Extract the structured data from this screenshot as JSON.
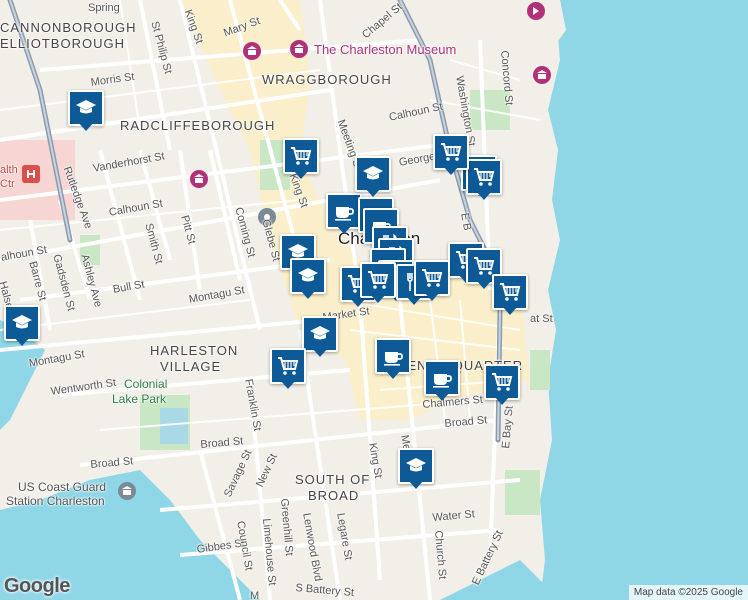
{
  "map": {
    "neighborhoods": {
      "cannonborough": "CANNONBOROUGH",
      "elliotborough": "ELLIOTBOROUGH",
      "wraggborough": "WRAGGBOROUGH",
      "radcliffeborough": "RADCLIFFEBOROUGH",
      "harleston": "HARLESTON",
      "village": "VILLAGE",
      "south_of": "SOUTH OF",
      "broad": "BROAD",
      "french_quarter": "FRENCH QUARTER"
    },
    "city": "Charleston",
    "parks": {
      "colonial_1": "Colonial",
      "colonial_2": "Lake Park"
    },
    "pois": {
      "museum": "The Charleston Museum",
      "coast_guard_1": "US Coast Guard",
      "coast_guard_2": "Station Charleston",
      "hospital_1": "alth",
      "hospital_2": "Ctr"
    },
    "streets": {
      "spring": "Spring",
      "king_top": "King St",
      "mary": "Mary St",
      "chapel": "Chapel St",
      "st_philip": "St Philip St",
      "morris": "Morris St",
      "concord": "Concord St",
      "washington": "Washington St",
      "calhoun_top": "Calhoun St",
      "rutledge": "Rutledge Ave",
      "vanderhorst": "Vanderhorst St",
      "meeting": "Meeting St",
      "george": "George St",
      "king_mid": "King St",
      "calhoun_left": "Calhoun St",
      "calhoun_far_left": "alhoun St",
      "smith": "Smith St",
      "pitt": "Pitt St",
      "coming": "Coming St",
      "glebe": "Glebe St",
      "barre": "Barre St",
      "gadsden": "Gadsden St",
      "ashley": "Ashley Ave",
      "bull": "Bull St",
      "montagu_mid": "Montagu St",
      "montagu_left": "Montagu St",
      "halsey": "Halsey",
      "wentworth": "Wentworth St",
      "market": "Market St",
      "e_bay_top": "E B",
      "franklin": "Franklin St",
      "chalmers": "Chalmers St",
      "broad_right": "Broad St",
      "broad_mid": "Broad St",
      "broad_left": "Broad St",
      "savage": "Savage St",
      "new": "New St",
      "king_low": "King St",
      "meeting_low": "Me",
      "e_bay_low": "E Bay St",
      "water": "Water St",
      "gibbes": "Gibbes St",
      "council": "Council St",
      "limehouse": "Limehouse St",
      "greenhill": "Greenhill St",
      "lenwood": "Lenwood Blvd",
      "legare": "Legare St",
      "church": "Church St",
      "e_battery": "E Battery St",
      "s_battery": "S Battery St",
      "eart_right": "at St",
      "m_low": "M"
    },
    "markers": [
      {
        "icon": "school"
      },
      {
        "icon": "school"
      },
      {
        "icon": "shopping-cart"
      },
      {
        "icon": "cafe"
      },
      {
        "icon": "school"
      },
      {
        "icon": "shopping-cart"
      },
      {
        "icon": "shopping-cart"
      },
      {
        "icon": "shopping-cart"
      },
      {
        "icon": "cafe"
      },
      {
        "icon": "cafe"
      },
      {
        "icon": "school"
      },
      {
        "icon": "school"
      },
      {
        "icon": "restaurant"
      },
      {
        "icon": "restaurant"
      },
      {
        "icon": "cafe"
      },
      {
        "icon": "shopping-cart"
      },
      {
        "icon": "shopping-cart"
      },
      {
        "icon": "shopping-cart"
      },
      {
        "icon": "restaurant"
      },
      {
        "icon": "restaurant"
      },
      {
        "icon": "shopping-cart"
      },
      {
        "icon": "shopping-cart"
      },
      {
        "icon": "school"
      },
      {
        "icon": "shopping-cart"
      },
      {
        "icon": "cafe"
      },
      {
        "icon": "cafe"
      },
      {
        "icon": "shopping-cart"
      },
      {
        "icon": "school"
      },
      {
        "icon": "shopping-cart"
      }
    ],
    "colors": {
      "water": "#8fd6e6",
      "land": "#f2efe9",
      "downtown": "#fbefc4",
      "park": "#c9e7c4",
      "hospital": "#f6d5d3",
      "marker": "#0d5a96",
      "highway": "#8a9bb0"
    }
  },
  "branding": {
    "logo": "Google",
    "attribution": "Map data ©2025 Google"
  }
}
